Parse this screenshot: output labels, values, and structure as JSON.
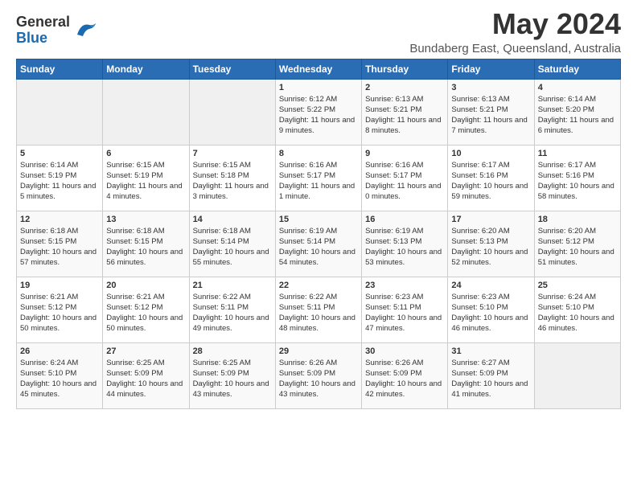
{
  "header": {
    "logo_general": "General",
    "logo_blue": "Blue",
    "month_title": "May 2024",
    "subtitle": "Bundaberg East, Queensland, Australia"
  },
  "days_of_week": [
    "Sunday",
    "Monday",
    "Tuesday",
    "Wednesday",
    "Thursday",
    "Friday",
    "Saturday"
  ],
  "weeks": [
    [
      {
        "day": "",
        "sunrise": "",
        "sunset": "",
        "daylight": "",
        "empty": true
      },
      {
        "day": "",
        "sunrise": "",
        "sunset": "",
        "daylight": "",
        "empty": true
      },
      {
        "day": "",
        "sunrise": "",
        "sunset": "",
        "daylight": "",
        "empty": true
      },
      {
        "day": "1",
        "sunrise": "Sunrise: 6:12 AM",
        "sunset": "Sunset: 5:22 PM",
        "daylight": "Daylight: 11 hours and 9 minutes."
      },
      {
        "day": "2",
        "sunrise": "Sunrise: 6:13 AM",
        "sunset": "Sunset: 5:21 PM",
        "daylight": "Daylight: 11 hours and 8 minutes."
      },
      {
        "day": "3",
        "sunrise": "Sunrise: 6:13 AM",
        "sunset": "Sunset: 5:21 PM",
        "daylight": "Daylight: 11 hours and 7 minutes."
      },
      {
        "day": "4",
        "sunrise": "Sunrise: 6:14 AM",
        "sunset": "Sunset: 5:20 PM",
        "daylight": "Daylight: 11 hours and 6 minutes."
      }
    ],
    [
      {
        "day": "5",
        "sunrise": "Sunrise: 6:14 AM",
        "sunset": "Sunset: 5:19 PM",
        "daylight": "Daylight: 11 hours and 5 minutes."
      },
      {
        "day": "6",
        "sunrise": "Sunrise: 6:15 AM",
        "sunset": "Sunset: 5:19 PM",
        "daylight": "Daylight: 11 hours and 4 minutes."
      },
      {
        "day": "7",
        "sunrise": "Sunrise: 6:15 AM",
        "sunset": "Sunset: 5:18 PM",
        "daylight": "Daylight: 11 hours and 3 minutes."
      },
      {
        "day": "8",
        "sunrise": "Sunrise: 6:16 AM",
        "sunset": "Sunset: 5:17 PM",
        "daylight": "Daylight: 11 hours and 1 minute."
      },
      {
        "day": "9",
        "sunrise": "Sunrise: 6:16 AM",
        "sunset": "Sunset: 5:17 PM",
        "daylight": "Daylight: 11 hours and 0 minutes."
      },
      {
        "day": "10",
        "sunrise": "Sunrise: 6:17 AM",
        "sunset": "Sunset: 5:16 PM",
        "daylight": "Daylight: 10 hours and 59 minutes."
      },
      {
        "day": "11",
        "sunrise": "Sunrise: 6:17 AM",
        "sunset": "Sunset: 5:16 PM",
        "daylight": "Daylight: 10 hours and 58 minutes."
      }
    ],
    [
      {
        "day": "12",
        "sunrise": "Sunrise: 6:18 AM",
        "sunset": "Sunset: 5:15 PM",
        "daylight": "Daylight: 10 hours and 57 minutes."
      },
      {
        "day": "13",
        "sunrise": "Sunrise: 6:18 AM",
        "sunset": "Sunset: 5:15 PM",
        "daylight": "Daylight: 10 hours and 56 minutes."
      },
      {
        "day": "14",
        "sunrise": "Sunrise: 6:18 AM",
        "sunset": "Sunset: 5:14 PM",
        "daylight": "Daylight: 10 hours and 55 minutes."
      },
      {
        "day": "15",
        "sunrise": "Sunrise: 6:19 AM",
        "sunset": "Sunset: 5:14 PM",
        "daylight": "Daylight: 10 hours and 54 minutes."
      },
      {
        "day": "16",
        "sunrise": "Sunrise: 6:19 AM",
        "sunset": "Sunset: 5:13 PM",
        "daylight": "Daylight: 10 hours and 53 minutes."
      },
      {
        "day": "17",
        "sunrise": "Sunrise: 6:20 AM",
        "sunset": "Sunset: 5:13 PM",
        "daylight": "Daylight: 10 hours and 52 minutes."
      },
      {
        "day": "18",
        "sunrise": "Sunrise: 6:20 AM",
        "sunset": "Sunset: 5:12 PM",
        "daylight": "Daylight: 10 hours and 51 minutes."
      }
    ],
    [
      {
        "day": "19",
        "sunrise": "Sunrise: 6:21 AM",
        "sunset": "Sunset: 5:12 PM",
        "daylight": "Daylight: 10 hours and 50 minutes."
      },
      {
        "day": "20",
        "sunrise": "Sunrise: 6:21 AM",
        "sunset": "Sunset: 5:12 PM",
        "daylight": "Daylight: 10 hours and 50 minutes."
      },
      {
        "day": "21",
        "sunrise": "Sunrise: 6:22 AM",
        "sunset": "Sunset: 5:11 PM",
        "daylight": "Daylight: 10 hours and 49 minutes."
      },
      {
        "day": "22",
        "sunrise": "Sunrise: 6:22 AM",
        "sunset": "Sunset: 5:11 PM",
        "daylight": "Daylight: 10 hours and 48 minutes."
      },
      {
        "day": "23",
        "sunrise": "Sunrise: 6:23 AM",
        "sunset": "Sunset: 5:11 PM",
        "daylight": "Daylight: 10 hours and 47 minutes."
      },
      {
        "day": "24",
        "sunrise": "Sunrise: 6:23 AM",
        "sunset": "Sunset: 5:10 PM",
        "daylight": "Daylight: 10 hours and 46 minutes."
      },
      {
        "day": "25",
        "sunrise": "Sunrise: 6:24 AM",
        "sunset": "Sunset: 5:10 PM",
        "daylight": "Daylight: 10 hours and 46 minutes."
      }
    ],
    [
      {
        "day": "26",
        "sunrise": "Sunrise: 6:24 AM",
        "sunset": "Sunset: 5:10 PM",
        "daylight": "Daylight: 10 hours and 45 minutes."
      },
      {
        "day": "27",
        "sunrise": "Sunrise: 6:25 AM",
        "sunset": "Sunset: 5:09 PM",
        "daylight": "Daylight: 10 hours and 44 minutes."
      },
      {
        "day": "28",
        "sunrise": "Sunrise: 6:25 AM",
        "sunset": "Sunset: 5:09 PM",
        "daylight": "Daylight: 10 hours and 43 minutes."
      },
      {
        "day": "29",
        "sunrise": "Sunrise: 6:26 AM",
        "sunset": "Sunset: 5:09 PM",
        "daylight": "Daylight: 10 hours and 43 minutes."
      },
      {
        "day": "30",
        "sunrise": "Sunrise: 6:26 AM",
        "sunset": "Sunset: 5:09 PM",
        "daylight": "Daylight: 10 hours and 42 minutes."
      },
      {
        "day": "31",
        "sunrise": "Sunrise: 6:27 AM",
        "sunset": "Sunset: 5:09 PM",
        "daylight": "Daylight: 10 hours and 41 minutes."
      },
      {
        "day": "",
        "sunrise": "",
        "sunset": "",
        "daylight": "",
        "empty": true
      }
    ]
  ]
}
